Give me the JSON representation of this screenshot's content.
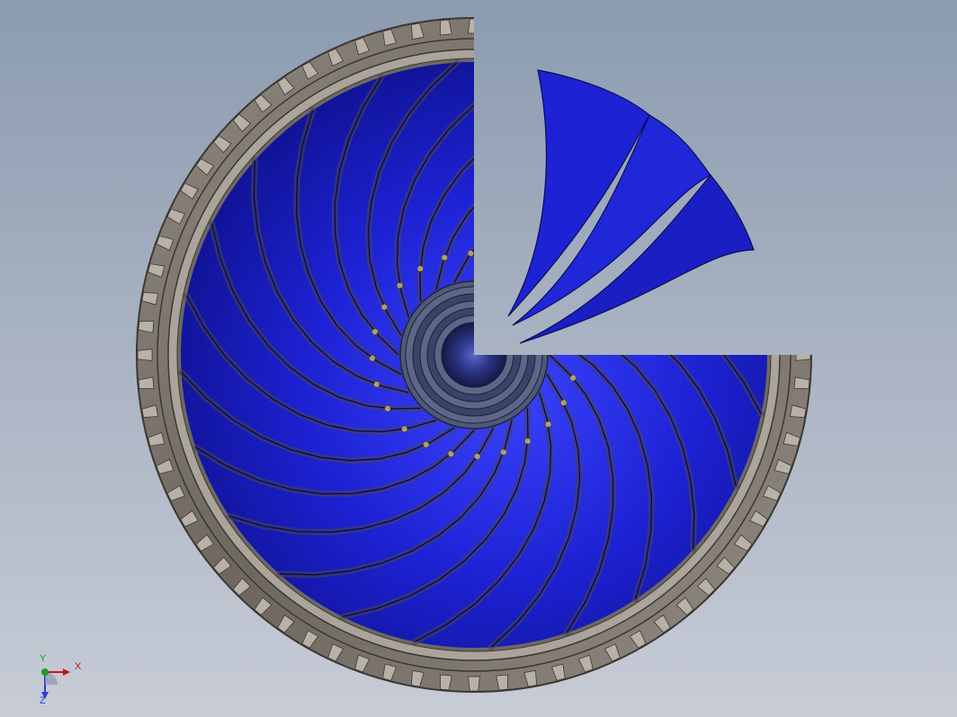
{
  "viewport": {
    "background_top": "#8c9bb0",
    "background_bottom": "#c7ccd6",
    "model": "fan-impeller-section-view"
  },
  "impeller": {
    "blade_count_visible": 24,
    "blade_color": "#1c1ec8",
    "blade_highlight": "#4a55ff",
    "blade_shadow": "#0b0f7a",
    "ring_color": "#76706a",
    "ring_light": "#b6b0a8",
    "hub_color": "#2b3a8a",
    "inner_glint": "#d8c24a"
  },
  "triad": {
    "x_label": "X",
    "y_label": "Y",
    "z_label": "Z",
    "x_color": "#c01818",
    "y_color": "#18a018",
    "z_color": "#2a3fd8"
  }
}
